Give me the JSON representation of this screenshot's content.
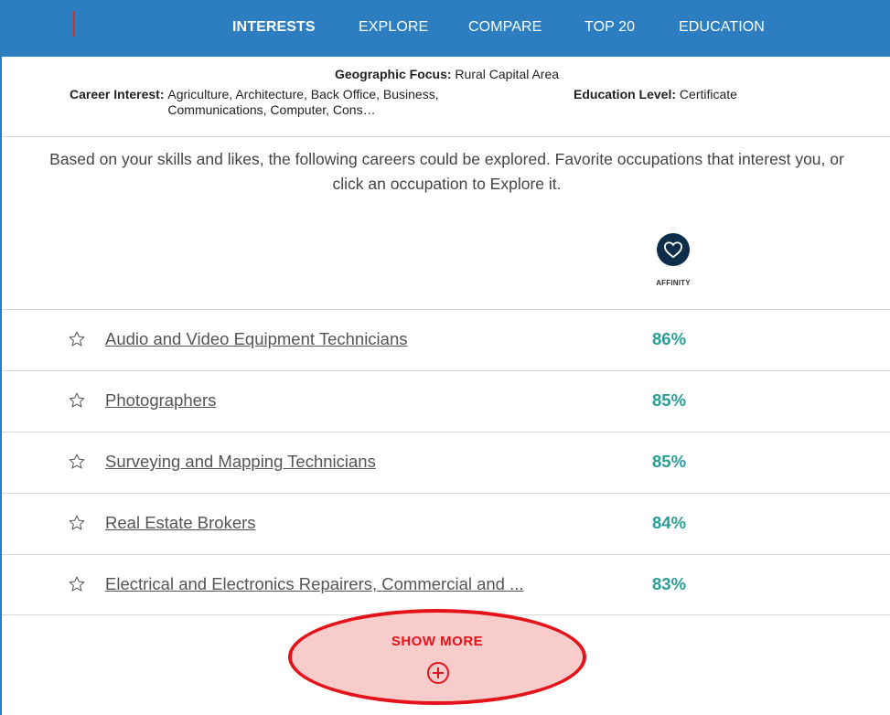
{
  "nav": {
    "tabs": [
      "INTERESTS",
      "EXPLORE",
      "COMPARE",
      "TOP 20",
      "EDUCATION"
    ],
    "active": "INTERESTS"
  },
  "filters": {
    "geo_label": "Geographic Focus:",
    "geo_value": "Rural Capital Area",
    "career_label": "Career Interest:",
    "career_value": "Agriculture, Architecture, Back Office, Business, Communications, Computer, Cons…",
    "edu_label": "Education Level:",
    "edu_value": "Certificate"
  },
  "intro": "Based on your skills and likes, the following careers could be explored. Favorite occupations that interest you, or click an occupation to Explore it.",
  "affinity": {
    "icon": "heart-icon",
    "label": "AFFINITY"
  },
  "occupations": [
    {
      "name": "Audio and Video Equipment Technicians",
      "affinity": "86%"
    },
    {
      "name": "Photographers",
      "affinity": "85%"
    },
    {
      "name": "Surveying and Mapping Technicians",
      "affinity": "85%"
    },
    {
      "name": "Real Estate Brokers",
      "affinity": "84%"
    },
    {
      "name": "Electrical and Electronics Repairers, Commercial and ...",
      "affinity": "83%"
    }
  ],
  "show_more": {
    "label": "SHOW MORE",
    "icon": "plus-circle-icon"
  },
  "colors": {
    "nav": "#2d7ec1",
    "affinity_text": "#2a9d96",
    "affinity_icon_bg": "#0e2d4b",
    "highlight": "#e4131a"
  }
}
